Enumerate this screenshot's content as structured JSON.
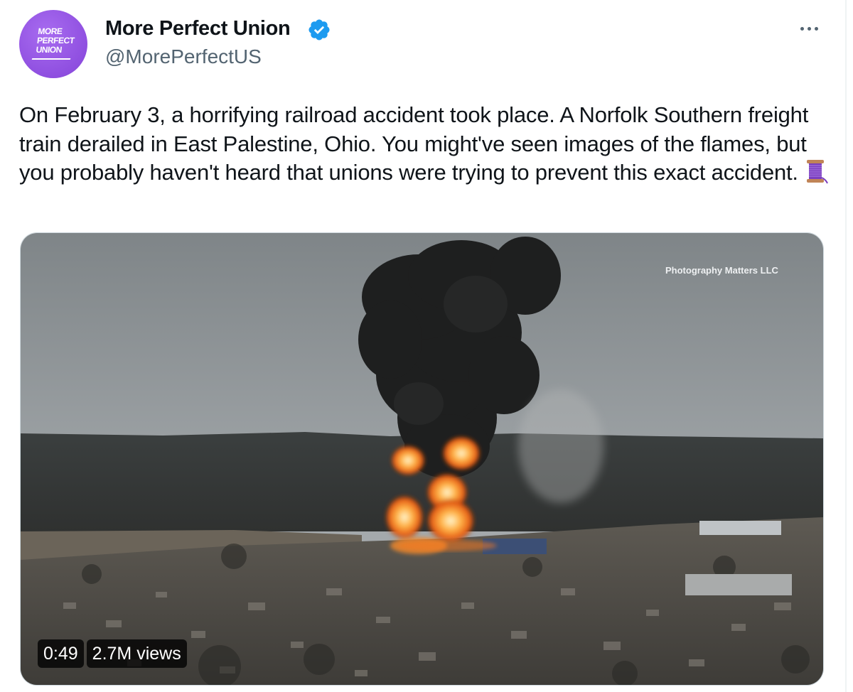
{
  "author": {
    "name": "More Perfect Union",
    "handle": "@MorePerfectUS",
    "verified": true,
    "avatar_text": "MORE\nPERFECT\nUNION",
    "avatar_color": "#9b5de5",
    "verified_color": "#1d9bf0"
  },
  "more_icon": "more-horizontal-icon",
  "tweet": {
    "text": "On February 3, a horrifying railroad accident took place. A Norfolk Southern freight train derailed in East Palestine, Ohio. You might've seen images of the flames, but you probably haven't heard that unions were trying to prevent this exact accident.",
    "emoji": "thread-spool-icon"
  },
  "media": {
    "watermark": "Photography Matters LLC",
    "duration": "0:49",
    "views": "2.7M views"
  }
}
